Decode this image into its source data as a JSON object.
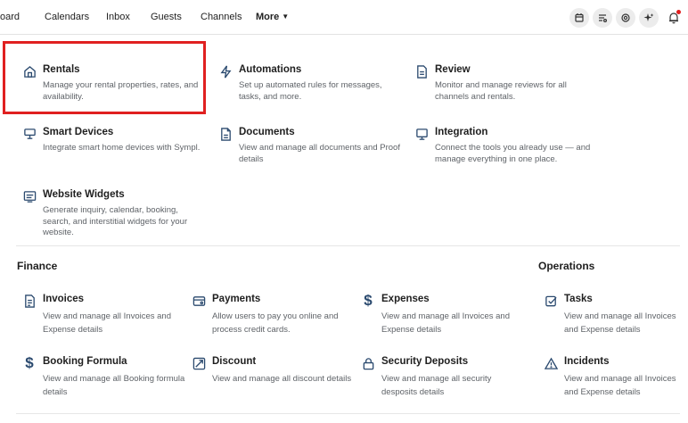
{
  "topnav": {
    "items": [
      "oard",
      "Calendars",
      "Inbox",
      "Guests",
      "Channels"
    ],
    "more": "More"
  },
  "topbar_icons": [
    "calendar-icon",
    "list-icon",
    "support-icon",
    "sparkle-icon",
    "bell-icon"
  ],
  "apps": [
    {
      "title": "Rentals",
      "desc": "Manage your rental properties, rates, and availability.",
      "icon": "home-icon"
    },
    {
      "title": "Automations",
      "desc": "Set up automated rules for messages, tasks, and more.",
      "icon": "lightning-icon"
    },
    {
      "title": "Review",
      "desc": "Monitor and manage reviews for all channels and rentals.",
      "icon": "document-icon"
    },
    {
      "title": "Smart Devices",
      "desc": "Integrate smart home devices with Sympl.",
      "icon": "device-icon"
    },
    {
      "title": "Documents",
      "desc": "View and manage all documents and Proof details",
      "icon": "file-icon"
    },
    {
      "title": "Integration",
      "desc": "Connect the tools you already use — and manage everything in one place.",
      "icon": "monitor-icon"
    },
    {
      "title": "Website Widgets",
      "desc": "Generate inquiry, calendar, booking, search, and interstitial widgets for your website.",
      "icon": "widget-icon"
    }
  ],
  "finance": {
    "heading": "Finance",
    "items": [
      {
        "title": "Invoices",
        "desc": "View and manage all Invoices and Expense details",
        "icon": "invoice-icon"
      },
      {
        "title": "Payments",
        "desc": "Allow users to pay you online and process credit cards.",
        "icon": "card-icon"
      },
      {
        "title": "Expenses",
        "desc": "View and manage all Invoices and Expense details",
        "icon": "dollar-icon"
      },
      {
        "title": "Booking Formula",
        "desc": "View and manage all Booking formula details",
        "icon": "dollar-icon"
      },
      {
        "title": "Discount",
        "desc": "View and manage all discount details",
        "icon": "discount-icon"
      },
      {
        "title": "Security Deposits",
        "desc": "View and manage all security desposits details",
        "icon": "lock-icon"
      }
    ]
  },
  "operations": {
    "heading": "Operations",
    "items": [
      {
        "title": "Tasks",
        "desc": "View and manage all Invoices and Expense details",
        "icon": "checkbox-icon"
      },
      {
        "title": "Incidents",
        "desc": "View and manage all Invoices and Expense details",
        "icon": "warning-icon"
      }
    ]
  },
  "colors": {
    "highlight": "#e02020",
    "icon": "#2b4a6f"
  }
}
